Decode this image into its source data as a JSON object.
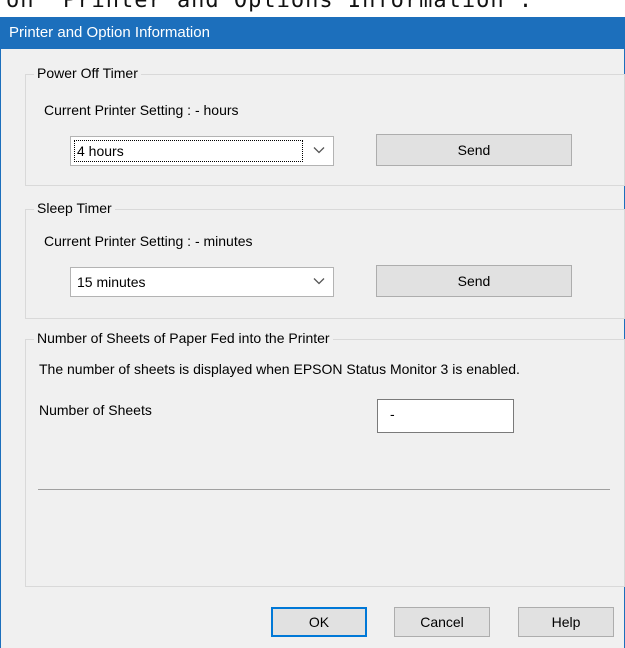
{
  "caption": "on \"Printer and Options Information\".",
  "window": {
    "title": "Printer and Option Information"
  },
  "power_off_timer": {
    "group_label": "Power Off Timer",
    "current_setting": "Current Printer Setting : - hours",
    "selected": "4 hours",
    "send_label": "Send"
  },
  "sleep_timer": {
    "group_label": "Sleep Timer",
    "current_setting": "Current Printer Setting : - minutes",
    "selected": "15 minutes",
    "send_label": "Send"
  },
  "sheets": {
    "group_label": "Number of Sheets of Paper Fed into the Printer",
    "note": "The number of sheets is displayed when EPSON Status Monitor 3 is enabled.",
    "count_label": "Number of Sheets",
    "count_value": "-"
  },
  "buttons": {
    "ok": "OK",
    "cancel": "Cancel",
    "help": "Help"
  },
  "icons": {
    "dropdown": "chevron-down-icon"
  },
  "colors": {
    "titlebar": "#1c6fbc",
    "default_button_border": "#0078d7",
    "dialog_bg": "#f0f0f0"
  }
}
